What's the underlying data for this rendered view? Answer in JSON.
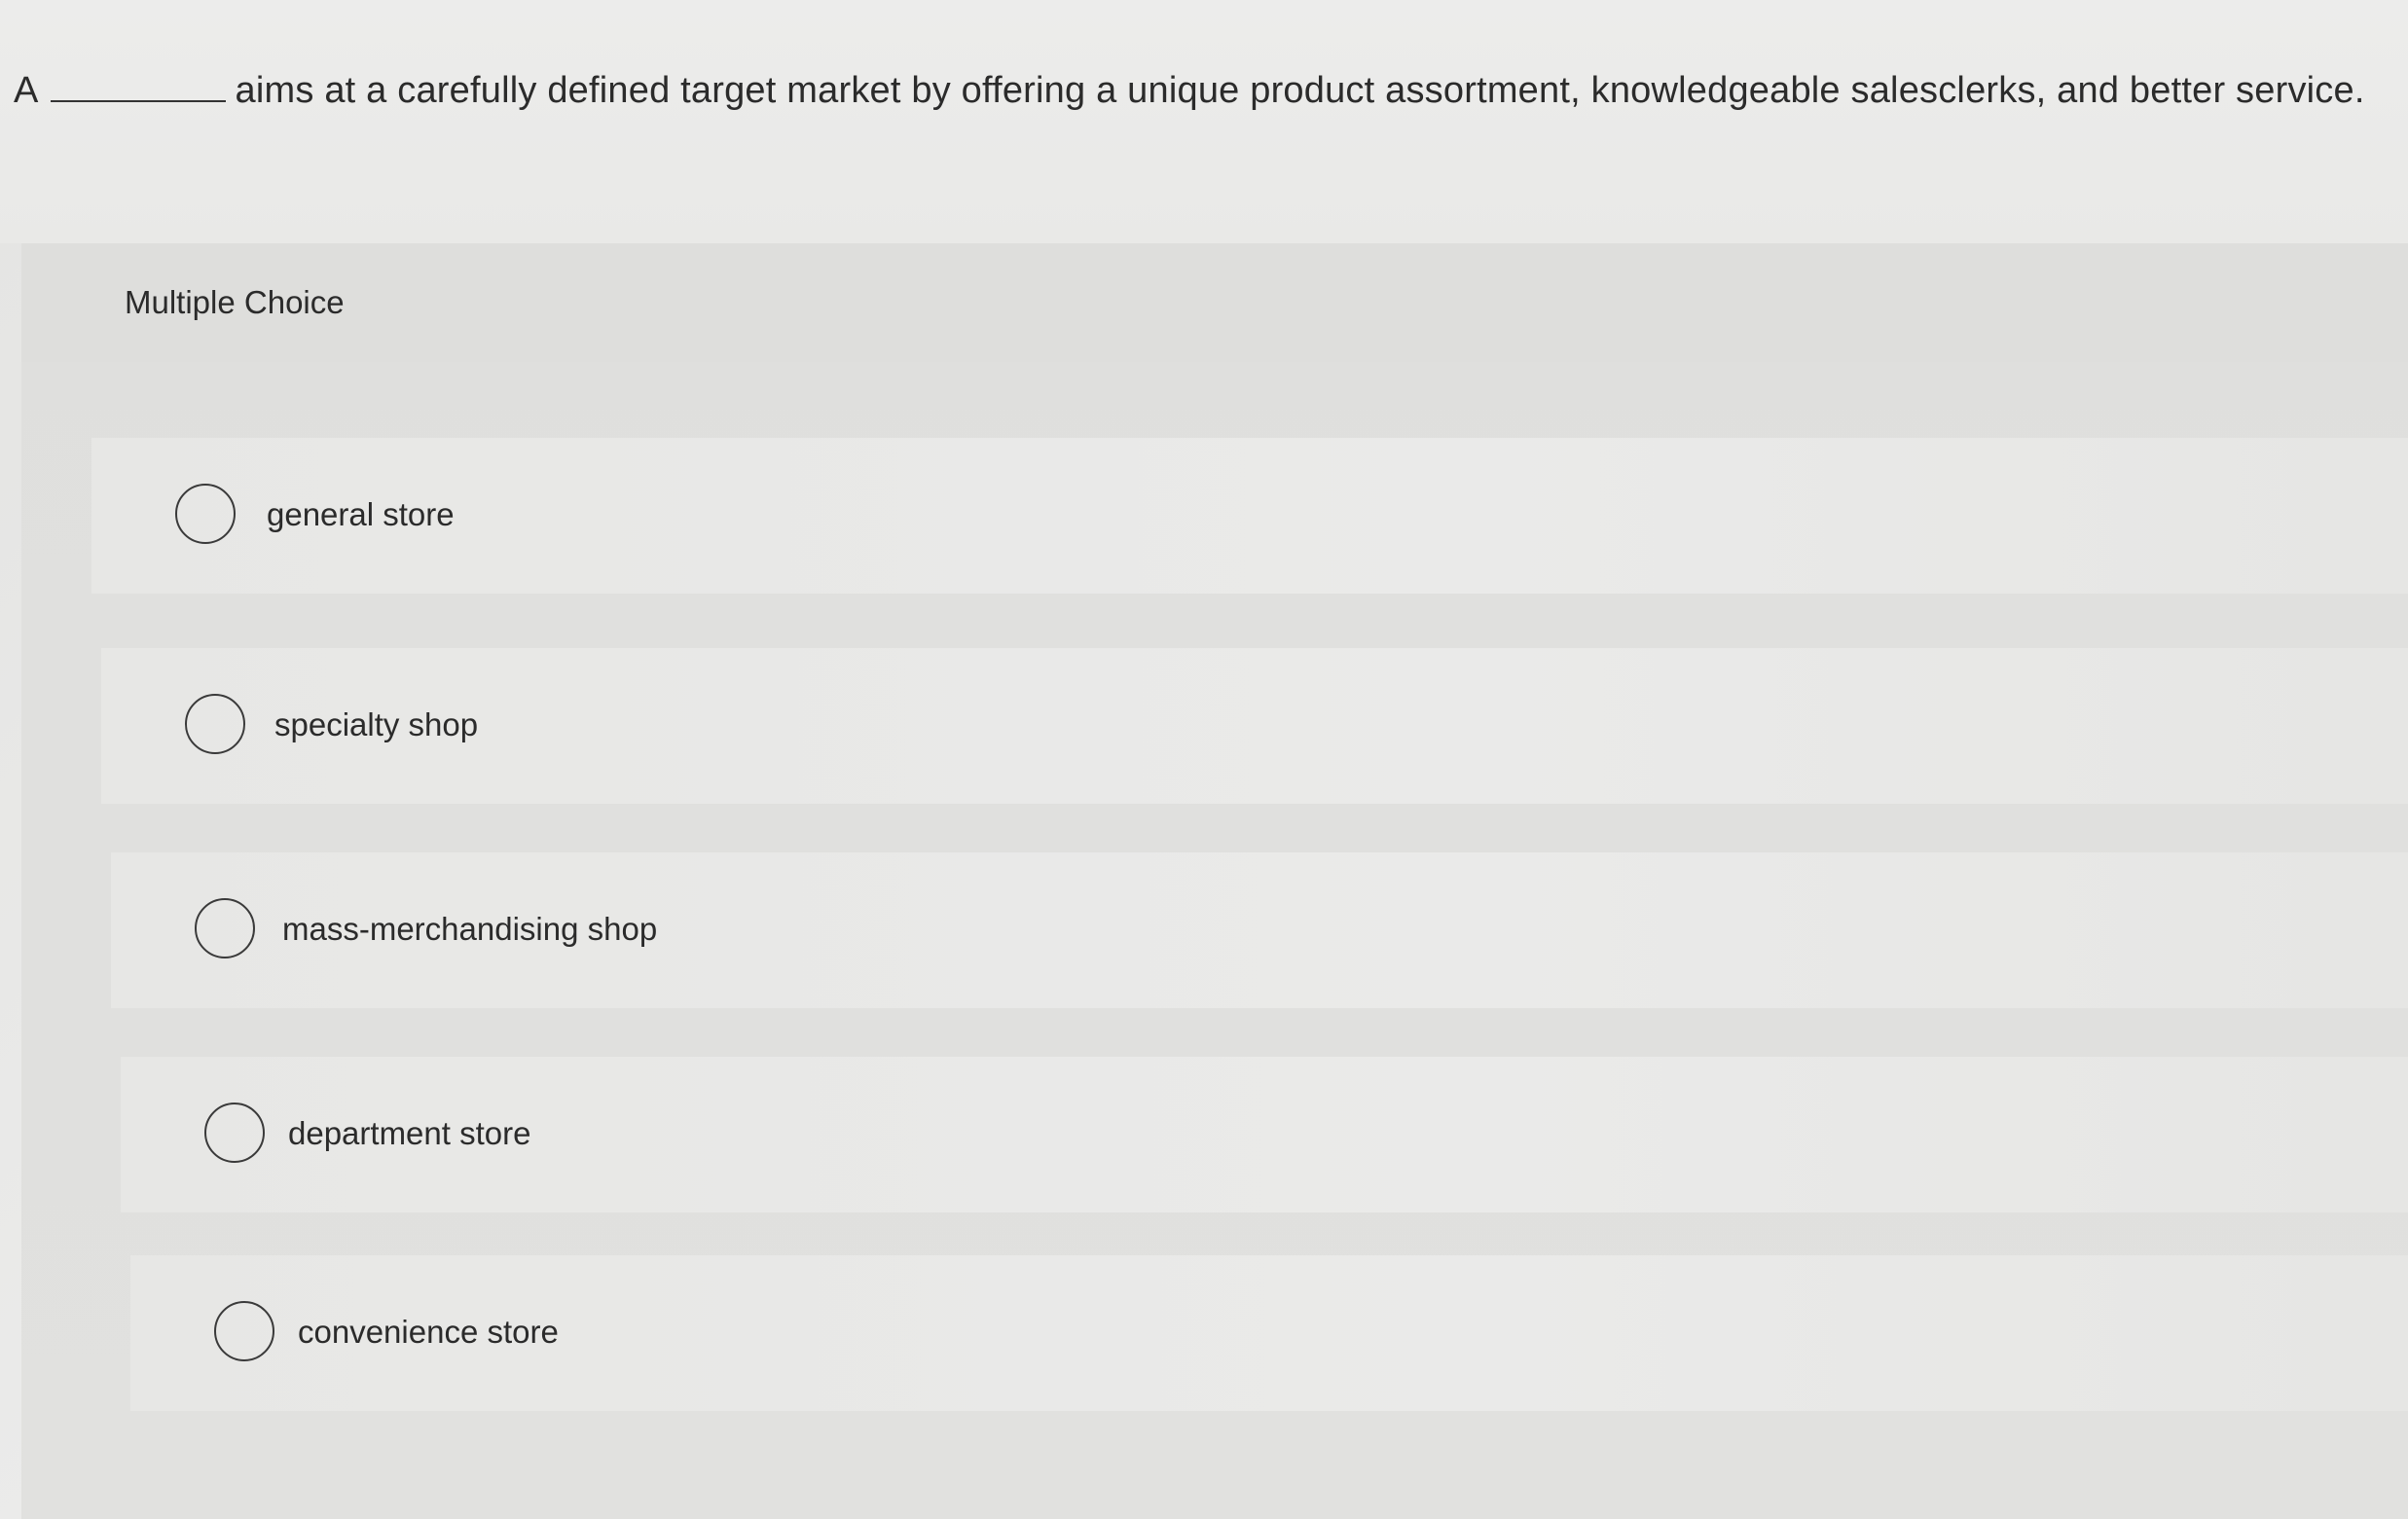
{
  "question": {
    "prefix": "A",
    "suffix": "aims at a carefully defined target market by offering a unique product assortment, knowledgeable salesclerks, and better service."
  },
  "multiple_choice": {
    "heading": "Multiple Choice",
    "options": [
      {
        "label": "general store"
      },
      {
        "label": "specialty shop"
      },
      {
        "label": "mass-merchandising shop"
      },
      {
        "label": "department store"
      },
      {
        "label": "convenience store"
      }
    ]
  },
  "colors": {
    "text": "#2b2b2b",
    "radio_border": "#3a3a3a",
    "background": "#e6e6e4"
  }
}
